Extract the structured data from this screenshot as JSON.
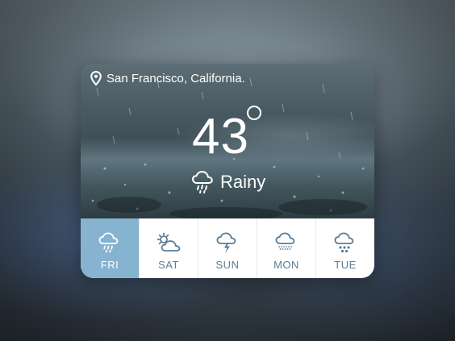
{
  "location": {
    "city": "San Francisco, California.",
    "icon": "location-pin-icon"
  },
  "current": {
    "temperature": "43",
    "condition": "Rainy",
    "icon": "cloud-rain-icon"
  },
  "forecast": [
    {
      "day": "FRI",
      "icon": "cloud-rain-icon",
      "active": true
    },
    {
      "day": "SAT",
      "icon": "sun-cloud-icon",
      "active": false
    },
    {
      "day": "SUN",
      "icon": "cloud-lightning-icon",
      "active": false
    },
    {
      "day": "MON",
      "icon": "cloud-drizzle-icon",
      "active": false
    },
    {
      "day": "TUE",
      "icon": "cloud-snow-icon",
      "active": false
    }
  ],
  "colors": {
    "accent": "#86b3cf",
    "forecast_text": "#5a7d96",
    "card_background": "#ffffff"
  }
}
